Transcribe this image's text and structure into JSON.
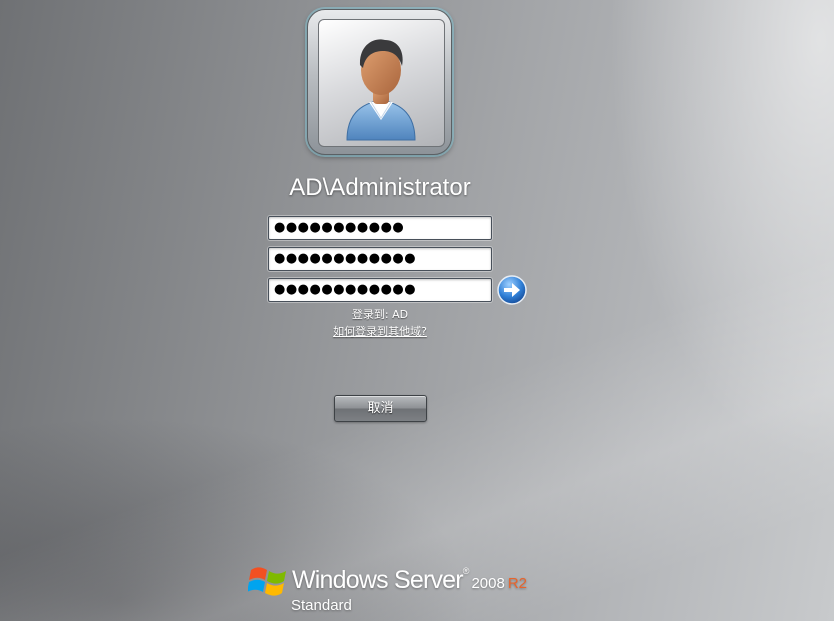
{
  "user": {
    "name": "AD\\Administrator",
    "avatar_icon": "user-avatar-icon"
  },
  "credentials": {
    "field_1_value": "●●●●●●●●●●●",
    "field_2_value": "●●●●●●●●●●●●",
    "field_3_value": "●●●●●●●●●●●●",
    "submit_icon": "arrow-right-icon"
  },
  "domain": {
    "logon_to": "登录到: AD",
    "other_domain_link": "如何登录到其他域?"
  },
  "actions": {
    "cancel_label": "取消"
  },
  "branding": {
    "logo_icon": "windows-flag-icon",
    "product_name": "Windows Server",
    "trademark": "®",
    "version": "2008",
    "release": "R2",
    "edition": "Standard",
    "accent_color": "#e8642c"
  }
}
